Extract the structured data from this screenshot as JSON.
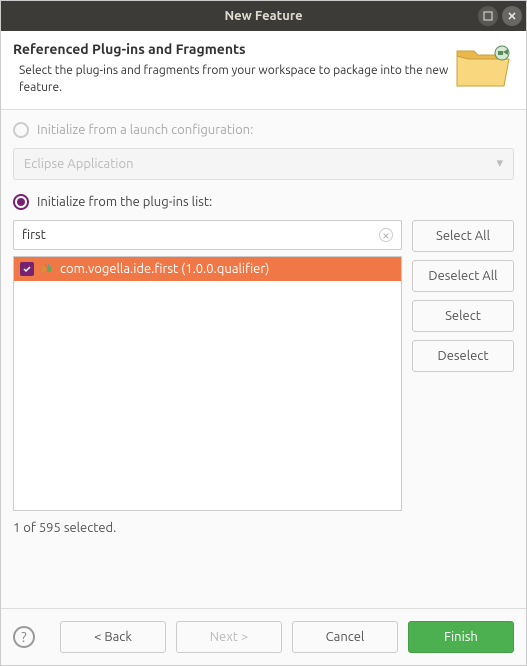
{
  "titlebar": {
    "title": "New Feature"
  },
  "header": {
    "title": "Referenced Plug-ins and Fragments",
    "description": "Select the plug-ins and fragments from your workspace to package into the new feature."
  },
  "radios": {
    "launch_config": "Initialize from a launch configuration:",
    "plugins_list": "Initialize from the plug-ins list:"
  },
  "combo": {
    "placeholder": "Eclipse Application"
  },
  "filter": {
    "value": "first"
  },
  "list": {
    "items": [
      {
        "label": "com.vogella.ide.first (1.0.0.qualifier)",
        "checked": true
      }
    ]
  },
  "side_buttons": {
    "select_all": "Select All",
    "deselect_all": "Deselect All",
    "select": "Select",
    "deselect": "Deselect"
  },
  "status": "1 of 595 selected.",
  "footer": {
    "back": "< Back",
    "next": "Next >",
    "cancel": "Cancel",
    "finish": "Finish"
  }
}
